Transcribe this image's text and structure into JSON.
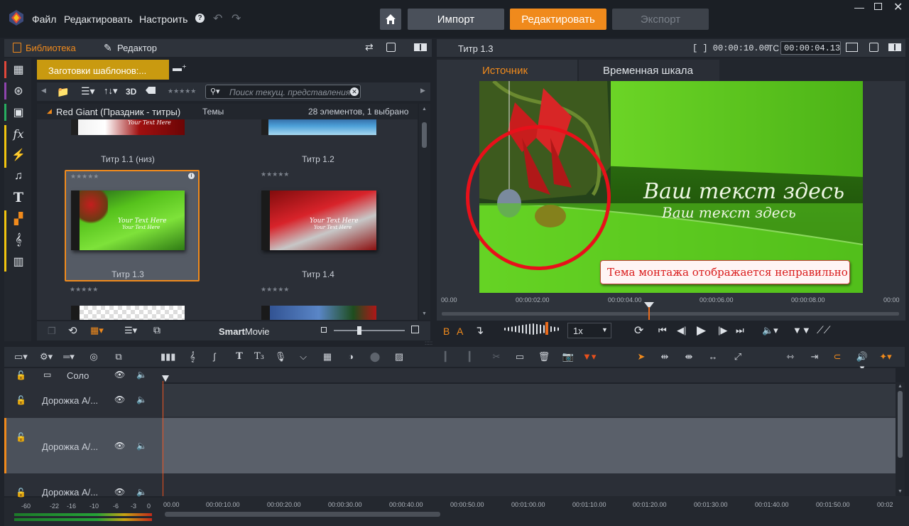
{
  "menu": {
    "file": "Файл",
    "edit": "Редактировать",
    "settings": "Настроить",
    "help": "?"
  },
  "modes": {
    "import": "Импорт",
    "edit": "Редактировать",
    "export": "Экспорт"
  },
  "library": {
    "tab_library": "Библиотека",
    "tab_editor": "Редактор",
    "collection_tab": "Заготовки шаблонов:...",
    "search_placeholder": "Поиск текущ. представления",
    "view_3d": "3D",
    "group_name": "Red Giant (Праздник - титры)",
    "group_type": "Темы",
    "group_count": "28 элементов, 1 выбрано",
    "items": [
      {
        "title": "Титр 1.1 (низ)"
      },
      {
        "title": "Титр 1.2"
      },
      {
        "title": "Титр 1.3"
      },
      {
        "title": "Титр 1.4"
      }
    ],
    "thumb_text_main": "Your Text Here",
    "thumb_text_sub": "Your Text Here",
    "smartmovie_bold": "Smart",
    "smartmovie_rest": "Movie"
  },
  "preview": {
    "title": "Титр 1.3",
    "duration": "[ ] 00:00:10.00",
    "tc_label": "TC",
    "tc_value": "00:00:04.13",
    "tab_source": "Источник",
    "tab_timeline": "Временная шкала",
    "video_text_main": "Ваш текст здесь",
    "video_text_sub": "Ваш текст здесь",
    "annotation": "Тема монтажа отображается неправильно",
    "ruler": [
      "00.00",
      "00:00:02.00",
      "00:00:04.00",
      "00:00:06.00",
      "00:00:08.00",
      "00:00"
    ],
    "speed": "1x",
    "label_b": "B",
    "label_a": "A"
  },
  "timeline": {
    "solo": "Соло",
    "tracks": [
      {
        "name": "Дорожка А/..."
      },
      {
        "name": "Дорожка А/..."
      },
      {
        "name": "Дорожка А/..."
      }
    ],
    "ticks": [
      "00.00",
      "00:00:10.00",
      "00:00:20.00",
      "00:00:30.00",
      "00:00:40.00",
      "00:00:50.00",
      "00:01:00.00",
      "00:01:10.00",
      "00:01:20.00",
      "00:01:30.00",
      "00:01:40.00",
      "00:01:50.00",
      "00:02"
    ],
    "meter": [
      "-60",
      "-22",
      "-16",
      "-10",
      "-6",
      "-3",
      "0"
    ]
  },
  "colors": {
    "accent": "#f08a1c",
    "panel": "#2a2f37",
    "bg": "#1f232a"
  }
}
